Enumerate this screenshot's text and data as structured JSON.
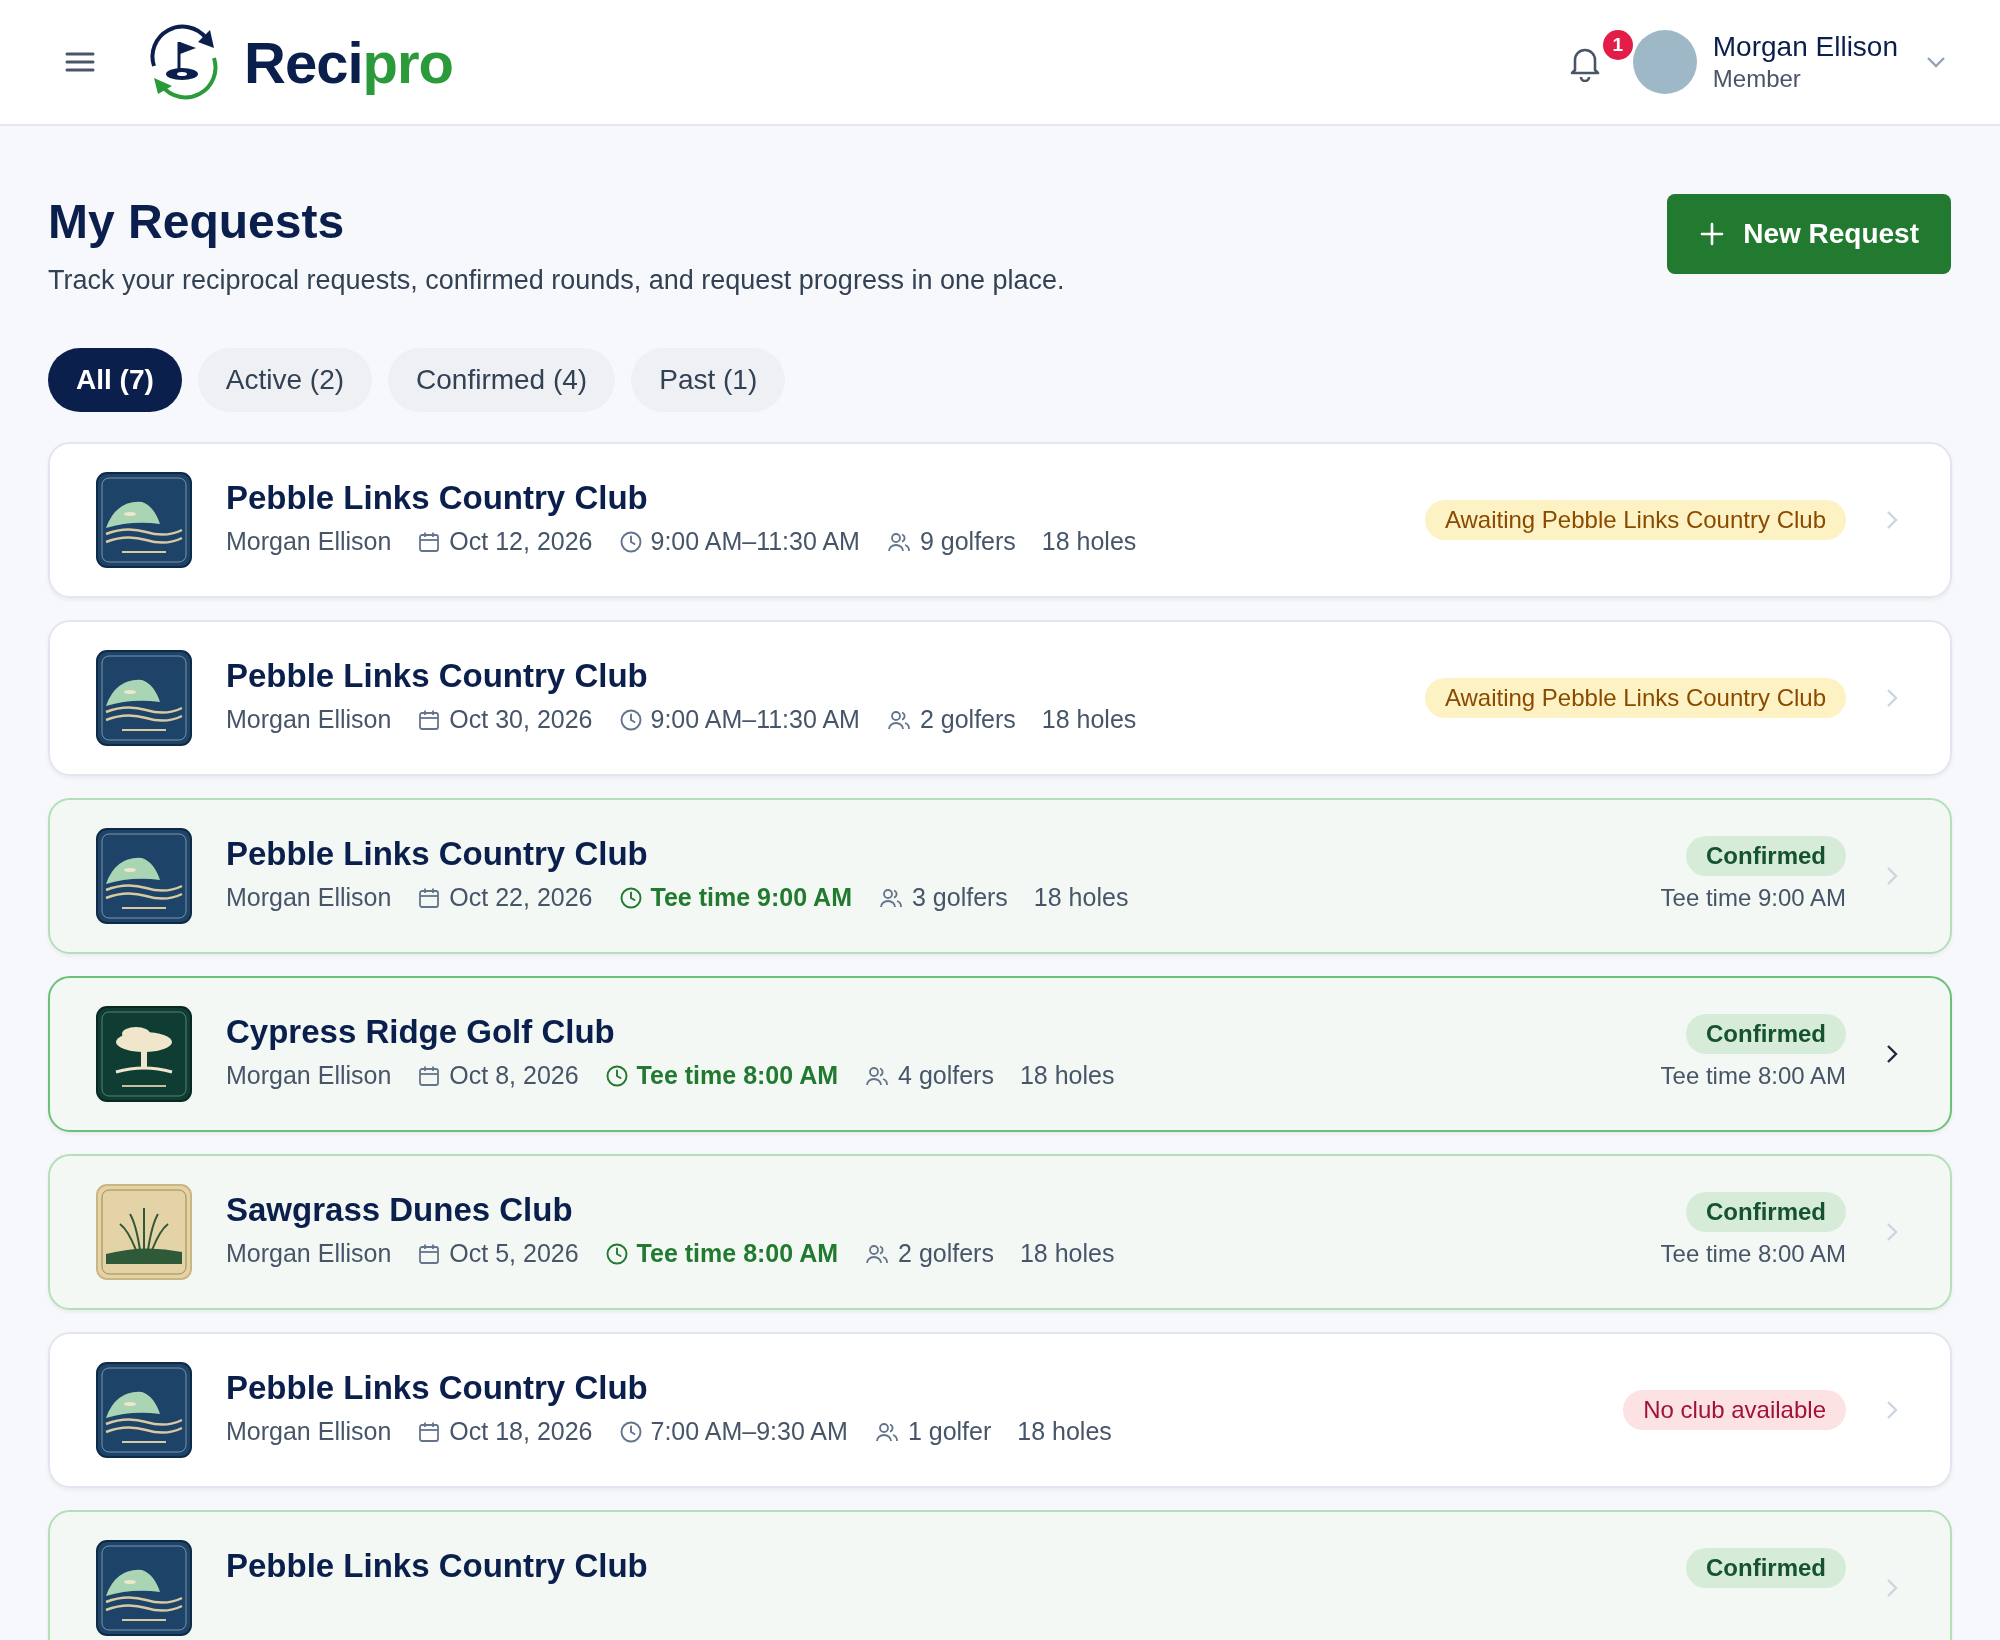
{
  "header": {
    "brand": {
      "part_1": "Reci",
      "part_2": "pro"
    },
    "notifications": {
      "count": "1"
    },
    "user": {
      "name": "Morgan Ellison",
      "role": "Member"
    }
  },
  "page": {
    "title": "My Requests",
    "subtitle": "Track your reciprocal requests, confirmed rounds, and request progress in one place.",
    "new_button": "New Request"
  },
  "tabs": [
    {
      "label": "All (7)",
      "selected": true
    },
    {
      "label": "Active (2)",
      "selected": false
    },
    {
      "label": "Confirmed (4)",
      "selected": false
    },
    {
      "label": "Past (1)",
      "selected": false
    }
  ],
  "requests": [
    {
      "club": "Pebble Links Country Club",
      "logo": {
        "kind": "pebble"
      },
      "member": "Morgan Ellison",
      "date": "Oct 12, 2026",
      "time": {
        "kind": "range",
        "text": "9:00 AM–11:30 AM"
      },
      "golfers": "9 golfers",
      "holes": "18 holes",
      "status": {
        "kind": "awaiting",
        "label": "Awaiting Pebble Links Country Club"
      },
      "selected": false
    },
    {
      "club": "Pebble Links Country Club",
      "logo": {
        "kind": "pebble"
      },
      "member": "Morgan Ellison",
      "date": "Oct 30, 2026",
      "time": {
        "kind": "range",
        "text": "9:00 AM–11:30 AM"
      },
      "golfers": "2 golfers",
      "holes": "18 holes",
      "status": {
        "kind": "awaiting",
        "label": "Awaiting Pebble Links Country Club"
      },
      "selected": false
    },
    {
      "club": "Pebble Links Country Club",
      "logo": {
        "kind": "pebble"
      },
      "member": "Morgan Ellison",
      "date": "Oct 22, 2026",
      "time": {
        "kind": "tee",
        "text": "Tee time 9:00 AM"
      },
      "golfers": "3 golfers",
      "holes": "18 holes",
      "status": {
        "kind": "confirmed",
        "label": "Confirmed",
        "note": "Tee time 9:00 AM"
      },
      "selected": false
    },
    {
      "club": "Cypress Ridge Golf Club",
      "logo": {
        "kind": "cypress"
      },
      "member": "Morgan Ellison",
      "date": "Oct 8, 2026",
      "time": {
        "kind": "tee",
        "text": "Tee time 8:00 AM"
      },
      "golfers": "4 golfers",
      "holes": "18 holes",
      "status": {
        "kind": "confirmed",
        "label": "Confirmed",
        "note": "Tee time 8:00 AM"
      },
      "selected": true
    },
    {
      "club": "Sawgrass Dunes Club",
      "logo": {
        "kind": "sawgrass"
      },
      "member": "Morgan Ellison",
      "date": "Oct 5, 2026",
      "time": {
        "kind": "tee",
        "text": "Tee time 8:00 AM"
      },
      "golfers": "2 golfers",
      "holes": "18 holes",
      "status": {
        "kind": "confirmed",
        "label": "Confirmed",
        "note": "Tee time 8:00 AM"
      },
      "selected": false
    },
    {
      "club": "Pebble Links Country Club",
      "logo": {
        "kind": "pebble"
      },
      "member": "Morgan Ellison",
      "date": "Oct 18, 2026",
      "time": {
        "kind": "range",
        "text": "7:00 AM–9:30 AM"
      },
      "golfers": "1 golfer",
      "holes": "18 holes",
      "status": {
        "kind": "unavailable",
        "label": "No club available"
      },
      "selected": false
    },
    {
      "club": "Pebble Links Country Club",
      "logo": {
        "kind": "pebble"
      },
      "status": {
        "kind": "confirmed",
        "label": "Confirmed"
      },
      "selected": false
    }
  ]
}
